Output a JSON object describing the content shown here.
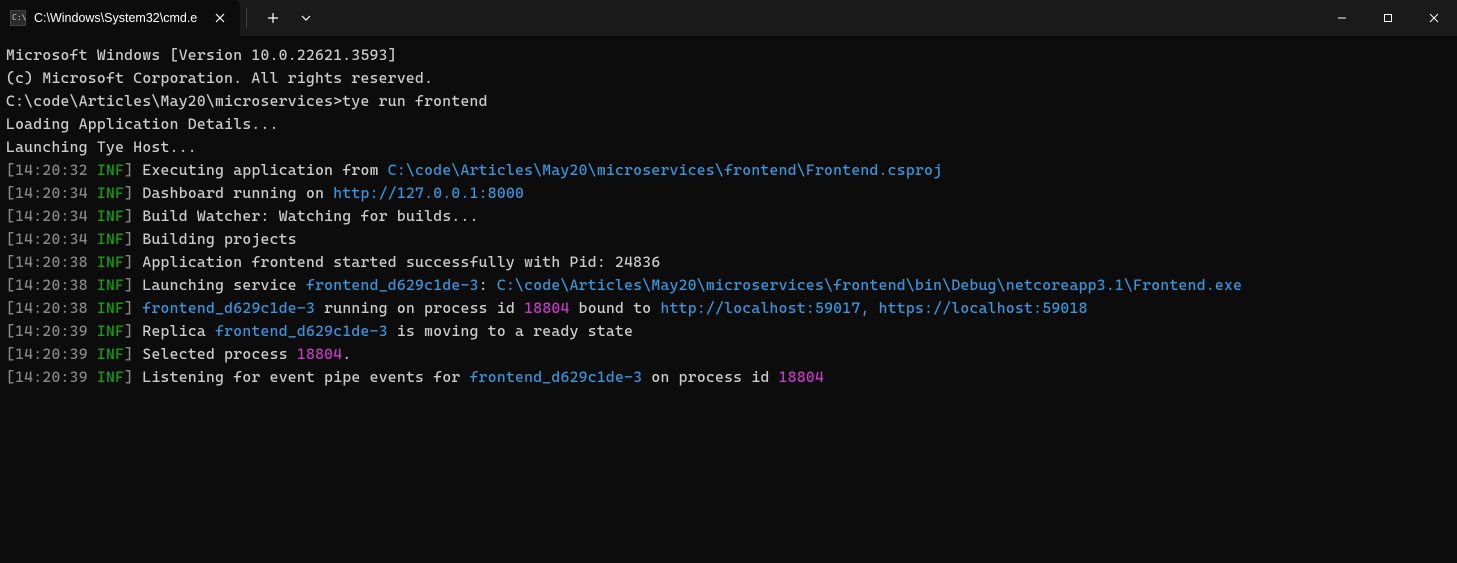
{
  "titlebar": {
    "tab_title": "C:\\Windows\\System32\\cmd.e"
  },
  "terminal": {
    "header1": "Microsoft Windows [Version 10.0.22621.3593]",
    "header2": "(c) Microsoft Corporation. All rights reserved.",
    "prompt": "C:\\code\\Articles\\May20\\microservices>",
    "command": "tye run frontend",
    "loading1": "Loading Application Details...",
    "loading2": "Launching Tye Host...",
    "lines": [
      {
        "time": "14:20:32",
        "level": "INF",
        "segments": [
          {
            "class": "white",
            "text": "Executing application from "
          },
          {
            "class": "cyan",
            "text": "C:\\code\\Articles\\May20\\microservices\\frontend\\Frontend.csproj"
          }
        ]
      },
      {
        "time": "14:20:34",
        "level": "INF",
        "segments": [
          {
            "class": "white",
            "text": "Dashboard running on "
          },
          {
            "class": "cyan",
            "text": "http://127.0.0.1:8000"
          }
        ]
      },
      {
        "time": "14:20:34",
        "level": "INF",
        "segments": [
          {
            "class": "white",
            "text": "Build Watcher: Watching for builds..."
          }
        ]
      },
      {
        "time": "14:20:34",
        "level": "INF",
        "segments": [
          {
            "class": "white",
            "text": "Building projects"
          }
        ]
      },
      {
        "time": "14:20:38",
        "level": "INF",
        "segments": [
          {
            "class": "white",
            "text": "Application frontend started successfully with Pid: 24836"
          }
        ]
      },
      {
        "time": "14:20:38",
        "level": "INF",
        "segments": [
          {
            "class": "white",
            "text": "Launching service "
          },
          {
            "class": "darkcyan",
            "text": "frontend_d629c1de-3"
          },
          {
            "class": "white",
            "text": ": "
          },
          {
            "class": "cyan",
            "text": "C:\\code\\Articles\\May20\\microservices\\frontend\\bin\\Debug\\netcoreapp3.1\\Frontend.exe"
          }
        ]
      },
      {
        "time": "14:20:38",
        "level": "INF",
        "segments": [
          {
            "class": "darkcyan",
            "text": "frontend_d629c1de-3"
          },
          {
            "class": "white",
            "text": " running on process id "
          },
          {
            "class": "magenta",
            "text": "18804"
          },
          {
            "class": "white",
            "text": " bound to "
          },
          {
            "class": "cyan",
            "text": "http://localhost:59017, https://localhost:59018"
          }
        ]
      },
      {
        "time": "14:20:39",
        "level": "INF",
        "segments": [
          {
            "class": "white",
            "text": "Replica "
          },
          {
            "class": "darkcyan",
            "text": "frontend_d629c1de-3"
          },
          {
            "class": "white",
            "text": " is moving to a ready state"
          }
        ]
      },
      {
        "time": "14:20:39",
        "level": "INF",
        "segments": [
          {
            "class": "white",
            "text": "Selected process "
          },
          {
            "class": "magenta",
            "text": "18804"
          },
          {
            "class": "white",
            "text": "."
          }
        ]
      },
      {
        "time": "14:20:39",
        "level": "INF",
        "segments": [
          {
            "class": "white",
            "text": "Listening for event pipe events for "
          },
          {
            "class": "darkcyan",
            "text": "frontend_d629c1de-3"
          },
          {
            "class": "white",
            "text": " on process id "
          },
          {
            "class": "magenta",
            "text": "18804"
          }
        ]
      }
    ]
  }
}
